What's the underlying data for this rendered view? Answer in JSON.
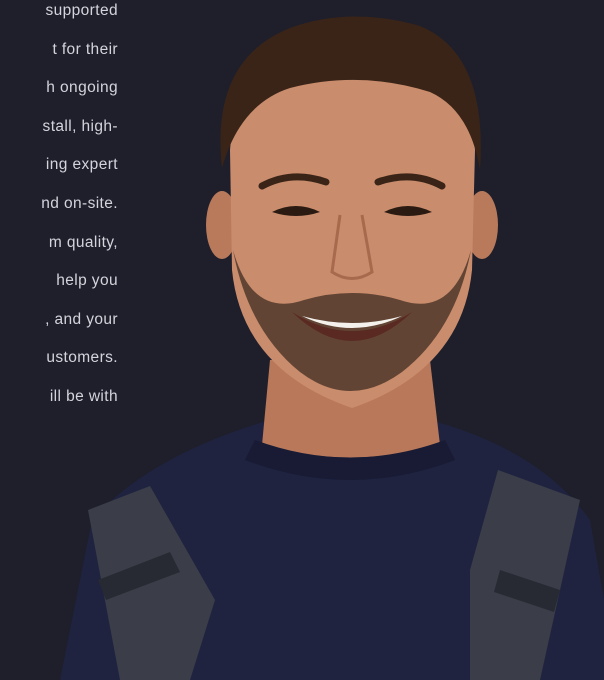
{
  "article": {
    "lines": [
      "supported",
      "t for their",
      "h ongoing",
      "stall, high-",
      "ing expert",
      "nd on-site.",
      "m quality,",
      "help you",
      ", and your",
      "ustomers.",
      "ill be with"
    ]
  },
  "photo": {
    "subject": "smiling worker portrait",
    "colors": {
      "background": "#1e1f2b",
      "shirt": "#1f2340",
      "straps": "#3b3e48",
      "skin": "#c98c6c",
      "hair": "#3a2418"
    }
  }
}
